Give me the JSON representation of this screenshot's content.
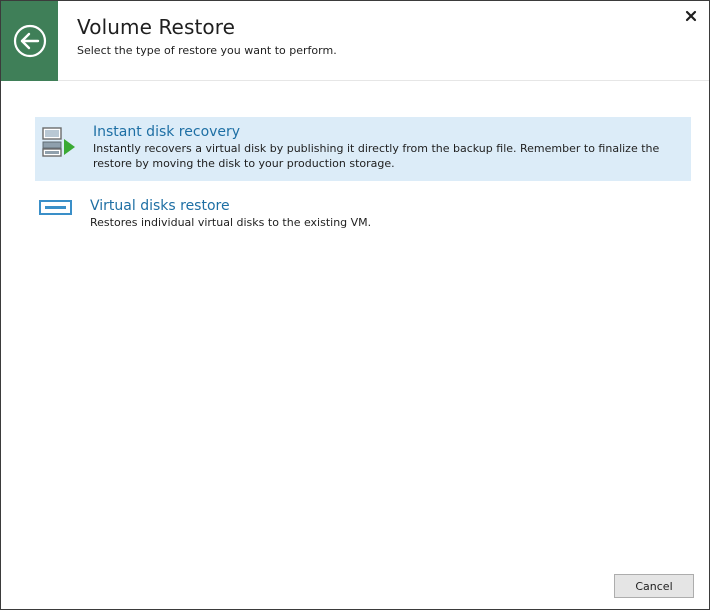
{
  "dialog": {
    "title": "Volume Restore",
    "subtitle": "Select the type of restore you want to perform."
  },
  "options": [
    {
      "title": "Instant disk recovery",
      "description": "Instantly recovers a virtual disk by publishing it directly from the backup file. Remember to finalize the restore by moving the disk to your production storage.",
      "selected": true,
      "icon": "instant-recovery-icon"
    },
    {
      "title": "Virtual disks restore",
      "description": "Restores individual virtual disks to the existing VM.",
      "selected": false,
      "icon": "virtual-disk-icon"
    }
  ],
  "footer": {
    "cancel_label": "Cancel"
  },
  "colors": {
    "accent_green": "#3f7f58",
    "link_blue": "#1e6fa4",
    "selection_bg": "#dcecf8",
    "arrow_green": "#3aaa35"
  },
  "icons": {
    "back": "back-arrow-icon",
    "close": "close-icon"
  }
}
